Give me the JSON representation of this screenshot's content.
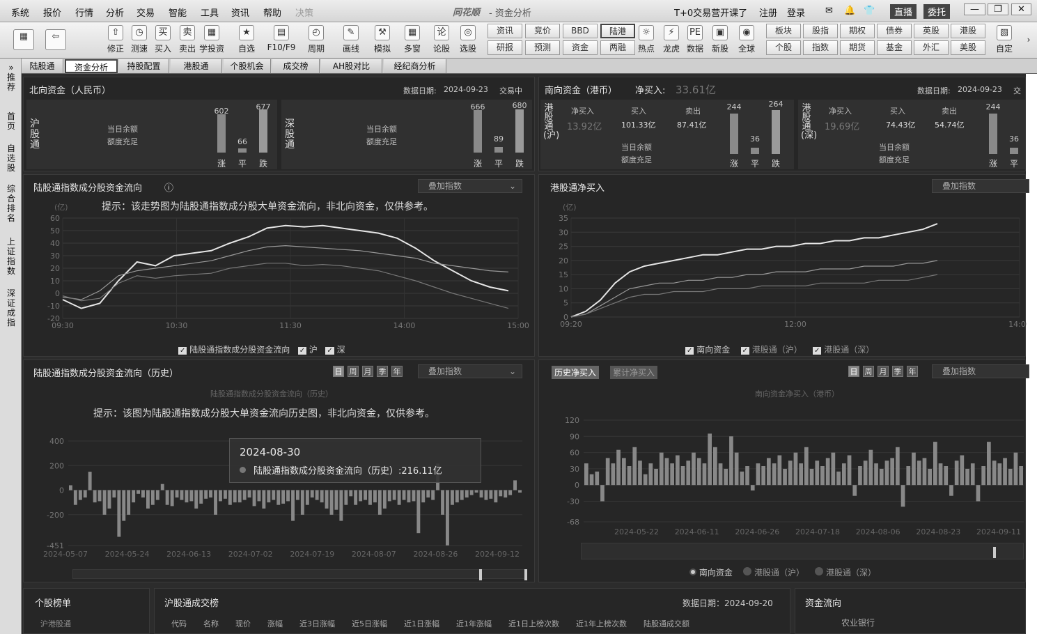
{
  "menu": {
    "items": [
      "系统",
      "报价",
      "行情",
      "分析",
      "交易",
      "智能",
      "工具",
      "资讯",
      "帮助",
      "决策"
    ],
    "logo": "同花顺",
    "window_title": "- 资金分析",
    "promo": "T+0交易营开课了",
    "register": "注册",
    "login": "登录",
    "live": "直播",
    "delegate": "委托"
  },
  "toolbar": {
    "items": [
      {
        "label": "修正",
        "icon": "⇧"
      },
      {
        "label": "测速",
        "icon": "◷"
      },
      {
        "label": "买入",
        "icon": "买"
      },
      {
        "label": "卖出",
        "icon": "卖"
      },
      {
        "label": "学投资",
        "icon": "▦"
      },
      {
        "label": "自选",
        "icon": "★"
      },
      {
        "label": "F10/F9",
        "icon": "▤"
      },
      {
        "label": "周期",
        "icon": "◴"
      },
      {
        "label": "画线",
        "icon": "✎"
      },
      {
        "label": "模拟",
        "icon": "⚒"
      },
      {
        "label": "多窗",
        "icon": "▦"
      },
      {
        "label": "论股",
        "icon": "论"
      },
      {
        "label": "选股",
        "icon": "◎"
      }
    ],
    "small_buttons": [
      [
        "资讯",
        "研报"
      ],
      [
        "竞价",
        "预测"
      ],
      [
        "BBD",
        "资金"
      ],
      [
        "陆港",
        "两融"
      ]
    ],
    "items2": [
      {
        "label": "热点",
        "icon": "☼"
      },
      {
        "label": "龙虎",
        "icon": "⚡"
      },
      {
        "label": "数据",
        "icon": "PE"
      },
      {
        "label": "新股",
        "icon": "▣"
      },
      {
        "label": "全球",
        "icon": "◉"
      }
    ],
    "small_buttons2": [
      [
        "板块",
        "个股"
      ],
      [
        "股指",
        "指数"
      ],
      [
        "期权",
        "期货"
      ],
      [
        "债券",
        "基金"
      ],
      [
        "英股",
        "外汇"
      ],
      [
        "港股",
        "美股"
      ]
    ],
    "custom": "自定"
  },
  "tabs": [
    "陆股通",
    "资金分析",
    "持股配置",
    "港股通",
    "个股机会",
    "成交榜",
    "AH股对比",
    "经纪商分析"
  ],
  "active_tab": "资金分析",
  "sidebar": [
    "推荐",
    "首页",
    "自选股",
    "综合排名",
    "上证指数",
    "深证成指"
  ],
  "north": {
    "title": "北向资金（人民币）",
    "date_label": "数据日期:",
    "date": "2024-09-23",
    "status": "交易中",
    "sh": {
      "name": "沪股通",
      "balance_label": "当日余额",
      "balance": "额度充足",
      "up": 602,
      "flat": 66,
      "down": 677
    },
    "sz": {
      "name": "深股通",
      "balance_label": "当日余额",
      "balance": "额度充足",
      "up": 666,
      "flat": 89,
      "down": 680
    },
    "labels": {
      "up": "涨",
      "flat": "平",
      "down": "跌"
    }
  },
  "south": {
    "title": "南向资金（港币）",
    "net_label": "净买入:",
    "net": "33.61亿",
    "date_label": "数据日期:",
    "date": "2024-09-23",
    "status": "交",
    "sh": {
      "name": "港股通(沪)",
      "net_label": "净买入",
      "net": "13.92亿",
      "buy_label": "买入",
      "buy": "101.33亿",
      "sell_label": "卖出",
      "sell": "87.41亿",
      "balance_label": "当日余额",
      "balance": "额度充足",
      "up": 244,
      "flat": 36,
      "down": 264
    },
    "sz": {
      "name": "港股通(深)",
      "net_label": "净买入",
      "net": "19.69亿",
      "buy_label": "买入",
      "buy": "74.43亿",
      "sell_label": "卖出",
      "sell": "54.74亿",
      "balance_label": "当日余额",
      "balance": "额度充足",
      "up": 244,
      "flat": 36
    }
  },
  "chart1": {
    "title": "陆股通指数成分股资金流向",
    "info_icon": "ⓘ",
    "dropdown": "叠加指数",
    "unit": "(亿)",
    "hint": "提示：该走势图为陆股通指数成分股大单资金流向，非北向资金，仅供参考。",
    "legend": [
      "陆股通指数成分股资金流向",
      "沪",
      "深"
    ]
  },
  "chart2": {
    "title": "港股通净买入",
    "dropdown": "叠加指数",
    "unit": "(亿)",
    "legend": [
      "南向资金",
      "港股通（沪）",
      "港股通（深）"
    ]
  },
  "chart3": {
    "title": "陆股通指数成分股资金流向（历史）",
    "periods": [
      "日",
      "周",
      "月",
      "季",
      "年"
    ],
    "dropdown": "叠加指数",
    "legend": "陆股通指数成分股资金流向（历史）",
    "hint": "提示：该图为陆股通指数成分股大单资金流向历史图，非北向资金，仅供参考。",
    "tooltip_date": "2024-08-30",
    "tooltip_label": "陆股通指数成分股资金流向（历史）:216.11亿"
  },
  "chart4": {
    "tabs": [
      "历史净买入",
      "累计净买入"
    ],
    "periods": [
      "日",
      "周",
      "月",
      "季",
      "年"
    ],
    "dropdown": "叠加指数",
    "legend": "南向资金净买入（港币）",
    "radios": [
      "南向资金",
      "港股通（沪）",
      "港股通（深）"
    ]
  },
  "bottom": {
    "rank_title": "个股榜单",
    "rank_sub": "沪港股通",
    "table_title": "沪股通成交榜",
    "date": "数据日期：2024-09-20",
    "cols": [
      "代码",
      "名称",
      "现价",
      "涨幅",
      "近3日涨幅",
      "近5日涨幅",
      "近1日涨幅",
      "近1年涨幅",
      "近1日上榜次数",
      "近1年上榜次数",
      "陆股通成交额"
    ],
    "flow_title": "资金流向",
    "flow_item": "农业银行"
  },
  "chart_data": [
    {
      "type": "line",
      "title": "陆股通指数成分股资金流向",
      "ylabel": "(亿)",
      "ylim": [
        -20,
        60
      ],
      "yticks": [
        60,
        50,
        40,
        30,
        20,
        10,
        0,
        -10,
        -20
      ],
      "xticks": [
        "09:30",
        "10:30",
        "11:30",
        "14:00",
        "15:00"
      ],
      "series": [
        {
          "name": "陆股通指数成分股资金流向",
          "values": [
            -5,
            -12,
            -8,
            10,
            25,
            22,
            30,
            32,
            34,
            40,
            45,
            52,
            54,
            53,
            54,
            52,
            50,
            48,
            44,
            36,
            26,
            18,
            10,
            5,
            2
          ]
        },
        {
          "name": "沪",
          "values": [
            -3,
            -5,
            2,
            14,
            18,
            20,
            22,
            24,
            26,
            30,
            34,
            37,
            38,
            37,
            36,
            35,
            34,
            32,
            30,
            28,
            24,
            22,
            20,
            18,
            17
          ]
        },
        {
          "name": "深",
          "values": [
            -2,
            -6,
            -4,
            8,
            14,
            12,
            14,
            15,
            16,
            20,
            22,
            24,
            24,
            22,
            23,
            22,
            20,
            18,
            14,
            10,
            5,
            0,
            -4,
            -8,
            -12
          ]
        }
      ]
    },
    {
      "type": "line",
      "title": "港股通净买入",
      "ylabel": "(亿)",
      "ylim": [
        0,
        35
      ],
      "yticks": [
        35,
        30,
        25,
        20,
        15,
        10,
        5,
        0
      ],
      "xticks": [
        "09:20",
        "12:00",
        "14:00"
      ],
      "series": [
        {
          "name": "南向资金",
          "values": [
            0,
            2,
            6,
            12,
            16,
            18,
            19,
            20,
            21,
            22,
            22,
            23,
            24,
            24,
            25,
            25,
            26,
            26,
            27,
            27,
            28,
            28,
            29,
            30,
            31,
            33
          ]
        },
        {
          "name": "港股通（沪）",
          "values": [
            0,
            1,
            4,
            7,
            10,
            11,
            12,
            12,
            13,
            13,
            14,
            14,
            15,
            15,
            16,
            16,
            16,
            17,
            17,
            17,
            18,
            18,
            18,
            19,
            19,
            20
          ]
        },
        {
          "name": "港股通（深）",
          "values": [
            0,
            1,
            3,
            5,
            7,
            8,
            8,
            9,
            9,
            9,
            10,
            10,
            10,
            11,
            11,
            11,
            11,
            12,
            12,
            12,
            12,
            13,
            13,
            13,
            14,
            15
          ]
        }
      ]
    },
    {
      "type": "bar",
      "title": "陆股通指数成分股资金流向（历史）",
      "ylim": [
        -451,
        400
      ],
      "yticks": [
        400,
        200,
        0,
        -200,
        -451
      ],
      "xticks": [
        "2024-05-07",
        "2024-05-24",
        "2024-06-13",
        "2024-07-02",
        "2024-07-19",
        "2024-08-07",
        "2024-08-26",
        "2024-09-12"
      ],
      "values": [
        40,
        -120,
        -80,
        -60,
        150,
        -100,
        -90,
        -200,
        -150,
        -60,
        -380,
        -250,
        -200,
        -100,
        -30,
        -60,
        -150,
        -120,
        -80,
        50,
        -120,
        -130,
        -60,
        -80,
        -100,
        -90,
        -150,
        -110,
        -70,
        -60,
        -200,
        -90,
        -70,
        -120,
        -100,
        -100,
        -80,
        -60,
        -130,
        -90,
        -150,
        -100,
        -80,
        -120,
        -110,
        -90,
        -250,
        -80,
        -200,
        -120,
        -60,
        -80,
        -100,
        -150,
        -200,
        -160,
        -250,
        -120,
        -50,
        -120,
        -90,
        -80,
        -120,
        -100,
        -200,
        -150,
        -90,
        -80,
        -120,
        -80,
        -100,
        -90,
        -350,
        -100,
        -60,
        -80,
        216,
        -200,
        -450,
        -120,
        -100,
        -80,
        -60,
        -40,
        -20,
        -60,
        -80,
        -70,
        -100,
        -50,
        -60,
        -40,
        80,
        -20
      ]
    },
    {
      "type": "bar",
      "title": "南向资金净买入（港币）",
      "ylim": [
        -68,
        120
      ],
      "yticks": [
        120,
        90,
        60,
        30,
        0,
        -30,
        -68
      ],
      "xticks": [
        "2024-05-22",
        "2024-06-11",
        "2024-06-26",
        "2024-07-18",
        "2024-08-06",
        "2024-08-23",
        "2024-09-11"
      ],
      "values": [
        40,
        20,
        25,
        -30,
        50,
        40,
        65,
        50,
        35,
        70,
        45,
        20,
        40,
        30,
        60,
        50,
        40,
        55,
        35,
        45,
        60,
        50,
        40,
        95,
        70,
        40,
        30,
        90,
        60,
        25,
        35,
        -10,
        40,
        35,
        50,
        40,
        55,
        30,
        45,
        60,
        40,
        70,
        30,
        45,
        35,
        50,
        60,
        25,
        40,
        55,
        -20,
        35,
        45,
        65,
        40,
        30,
        45,
        50,
        70,
        -40,
        35,
        60,
        45,
        50,
        30,
        80,
        40,
        35,
        -20,
        45,
        55,
        30,
        40,
        -30,
        35,
        80,
        45,
        40,
        50,
        30,
        60,
        35
      ]
    }
  ]
}
